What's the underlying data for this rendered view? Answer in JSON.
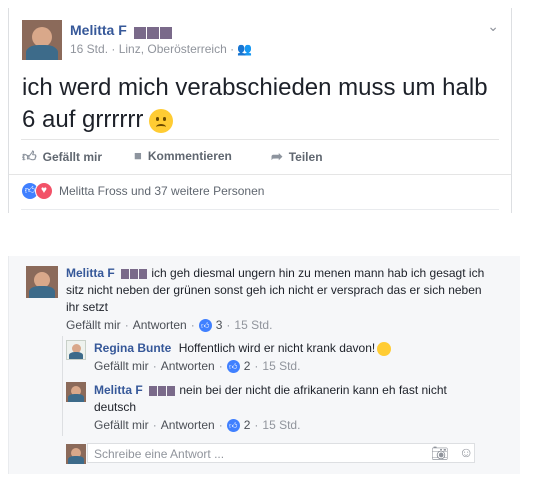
{
  "post": {
    "author": "Melitta F",
    "time": "16 Std.",
    "location": "Linz, Oberösterreich",
    "text": "ich werd mich verabschieden muss um halb 6 auf grrrrrr",
    "actions": {
      "like": "Gefällt mir",
      "comment": "Kommentieren",
      "share": "Teilen"
    },
    "reactions": "Melitta Fross und 37 weitere Personen",
    "colors": {
      "link": "#365899",
      "like_blue": "#4080ff",
      "love_red": "#f25268"
    }
  },
  "comments": [
    {
      "author": "Melitta F",
      "text": "ich geh diesmal ungern hin zu menen mann hab ich gesagt ich sitz nicht neben der grünen sonst geh ich nicht er versprach das er sich neben ihr setzt",
      "like": "Gefällt mir",
      "reply": "Antworten",
      "likes": "3",
      "time": "15 Std."
    },
    {
      "author": "Regina Bunte",
      "text": "Hoffentlich wird er nicht krank davon!",
      "like": "Gefällt mir",
      "reply": "Antworten",
      "likes": "2",
      "time": "15 Std."
    },
    {
      "author": "Melitta F",
      "text": "nein bei der nicht die afrikanerin kann eh fast nicht deutsch",
      "like": "Gefällt mir",
      "reply": "Antworten",
      "likes": "2",
      "time": "15 Std."
    }
  ],
  "reply_box": {
    "placeholder": "Schreibe eine Antwort ..."
  }
}
